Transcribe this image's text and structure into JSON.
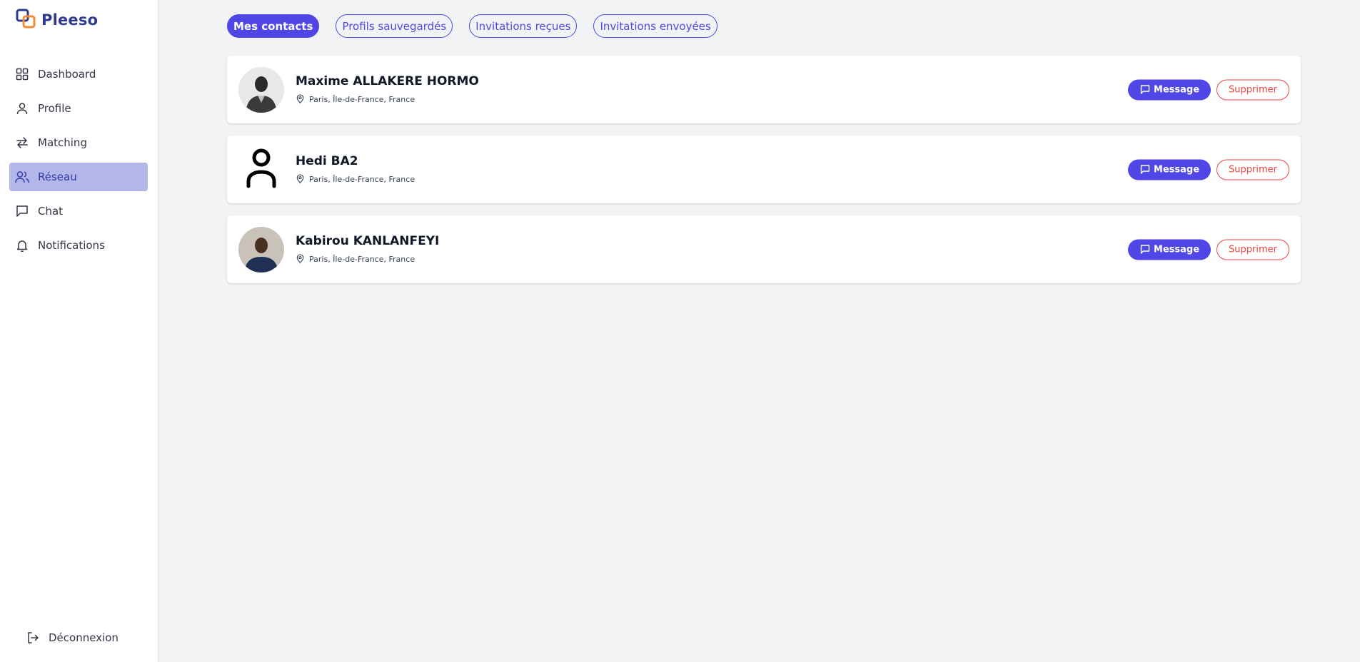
{
  "brand": {
    "name": "Pleeso",
    "logo_colors": [
      "#2f3a8f",
      "#f28b30"
    ]
  },
  "sidebar": {
    "items": [
      {
        "label": "Dashboard",
        "icon": "grid-icon"
      },
      {
        "label": "Profile",
        "icon": "user-icon"
      },
      {
        "label": "Matching",
        "icon": "arrows-swap-icon"
      },
      {
        "label": "Réseau",
        "icon": "users-icon",
        "active": true
      },
      {
        "label": "Chat",
        "icon": "message-icon"
      },
      {
        "label": "Notifications",
        "icon": "bell-icon"
      }
    ],
    "logout_label": "Déconnexion"
  },
  "tabs": [
    {
      "label": "Mes contacts",
      "active": true
    },
    {
      "label": "Profils sauvegardés"
    },
    {
      "label": "Invitations reçues"
    },
    {
      "label": "Invitations envoyées"
    }
  ],
  "contacts": [
    {
      "name": "Maxime ALLAKERE HORMO",
      "location": "Paris, Île-de-France, France",
      "avatar": "photo"
    },
    {
      "name": "Hedi BA2",
      "location": "Paris, Île-de-France, France",
      "avatar": "placeholder"
    },
    {
      "name": "Kabirou KANLANFEYI",
      "location": "Paris, Île-de-France, France",
      "avatar": "photo"
    }
  ],
  "actions": {
    "message_label": "Message",
    "delete_label": "Supprimer"
  },
  "colors": {
    "accent": "#4f46e5",
    "danger": "#ef4444",
    "active_nav_bg": "#b3b6e8"
  }
}
